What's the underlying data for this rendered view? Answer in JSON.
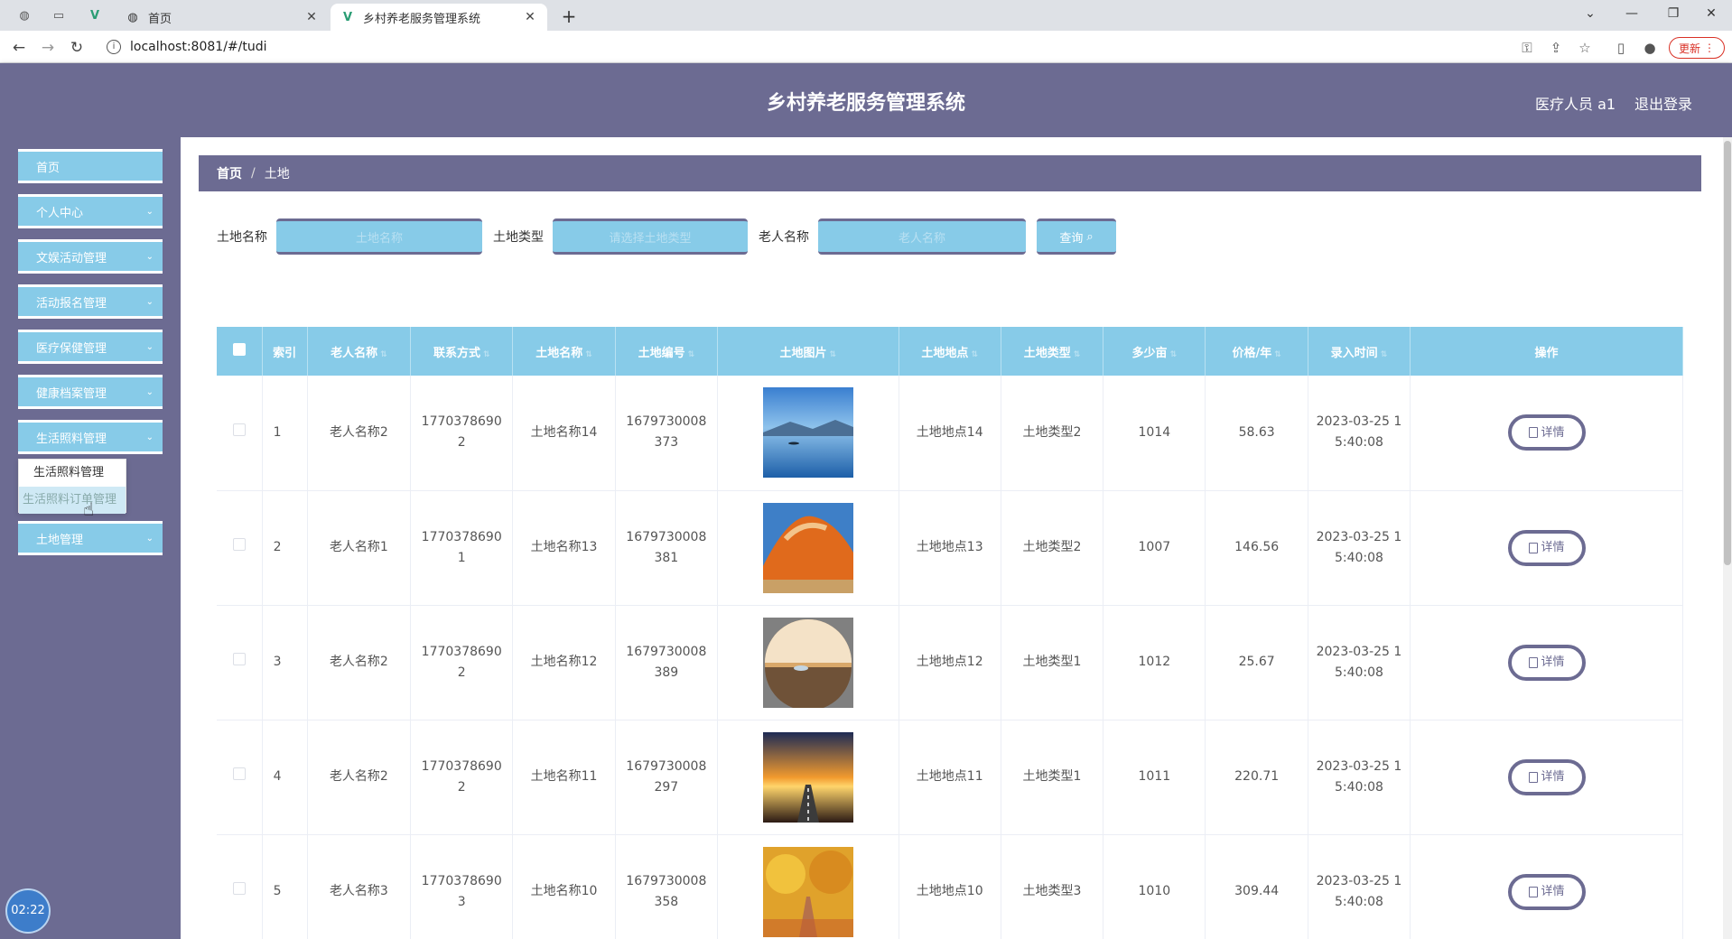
{
  "browser": {
    "tabs": [
      {
        "title": "首页",
        "active": false
      },
      {
        "title": "乡村养老服务管理系统",
        "active": true
      }
    ],
    "url": "localhost:8081/#/tudi",
    "update_label": "更新"
  },
  "header": {
    "title": "乡村养老服务管理系统",
    "user": "医疗人员 a1",
    "logout": "退出登录"
  },
  "sidebar": {
    "items": [
      {
        "label": "首页"
      },
      {
        "label": "个人中心"
      },
      {
        "label": "文娱活动管理"
      },
      {
        "label": "活动报名管理"
      },
      {
        "label": "医疗保健管理"
      },
      {
        "label": "健康档案管理"
      },
      {
        "label": "生活照料管理"
      },
      {
        "label": "土地管理"
      }
    ],
    "submenu": [
      "生活照料管理",
      "生活照料订单管理"
    ],
    "timer": "02:22"
  },
  "breadcrumb": {
    "home": "首页",
    "current": "土地"
  },
  "search": {
    "land_name_label": "土地名称",
    "land_name_placeholder": "土地名称",
    "land_type_label": "土地类型",
    "land_type_placeholder": "请选择土地类型",
    "elder_name_label": "老人名称",
    "elder_name_placeholder": "老人名称",
    "query_button": "查询"
  },
  "table": {
    "headers": [
      "索引",
      "老人名称",
      "联系方式",
      "土地名称",
      "土地编号",
      "土地图片",
      "土地地点",
      "土地类型",
      "多少亩",
      "价格/年",
      "录入时间",
      "操作"
    ],
    "detail_label": "详情",
    "rows": [
      {
        "index": "1",
        "elder": "老人名称2",
        "phone": "17703786902",
        "name": "土地名称14",
        "code": "1679730008373",
        "image": "lake",
        "place": "土地地点14",
        "type": "土地类型2",
        "mu": "1014",
        "price": "58.63",
        "time": "2023-03-25 15:40:08"
      },
      {
        "index": "2",
        "elder": "老人名称1",
        "phone": "17703786901",
        "name": "土地名称13",
        "code": "1679730008381",
        "image": "rock",
        "place": "土地地点13",
        "type": "土地类型2",
        "mu": "1007",
        "price": "146.56",
        "time": "2023-03-25 15:40:08"
      },
      {
        "index": "3",
        "elder": "老人名称2",
        "phone": "17703786902",
        "name": "土地名称12",
        "code": "1679730008389",
        "image": "globe",
        "place": "土地地点12",
        "type": "土地类型1",
        "mu": "1012",
        "price": "25.67",
        "time": "2023-03-25 15:40:08"
      },
      {
        "index": "4",
        "elder": "老人名称2",
        "phone": "17703786902",
        "name": "土地名称11",
        "code": "1679730008297",
        "image": "sunset-road",
        "place": "土地地点11",
        "type": "土地类型1",
        "mu": "1011",
        "price": "220.71",
        "time": "2023-03-25 15:40:08"
      },
      {
        "index": "5",
        "elder": "老人名称3",
        "phone": "17703786903",
        "name": "土地名称10",
        "code": "1679730008358",
        "image": "autumn-path",
        "place": "土地地点10",
        "type": "土地类型3",
        "mu": "1010",
        "price": "309.44",
        "time": "2023-03-25 15:40:08"
      }
    ]
  }
}
